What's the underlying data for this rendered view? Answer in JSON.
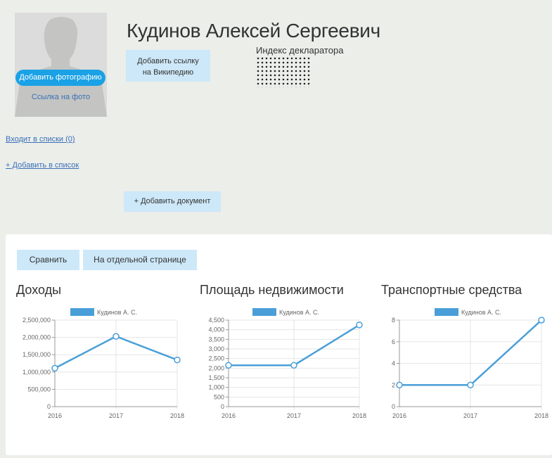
{
  "profile": {
    "name": "Кудинов Алексей Сергеевич",
    "add_photo": "Добавить фотографию",
    "photo_link": "Ссылка на фото",
    "wiki_line1": "Добавить ссылку",
    "wiki_line2": "на Википедию",
    "index_label": "Индекс декларатора",
    "lists_link": "Входит в списки (0)",
    "add_to_list": "+ Добавить в список",
    "add_document": "+ Добавить документ"
  },
  "panel": {
    "compare": "Сравнить",
    "separate_page": "На отдельной странице"
  },
  "colors": {
    "accent": "#1aa1e6",
    "button_bg": "#cde8f8",
    "series": "#4a9fd8",
    "link": "#3a70b8"
  },
  "chart_data": [
    {
      "type": "line",
      "title": "Доходы",
      "legend": "Кудинов А. С.",
      "x": [
        "2016",
        "2017",
        "2018"
      ],
      "values": [
        1110000,
        2030000,
        1350000
      ],
      "ylim": [
        0,
        2500000
      ],
      "yticks": [
        0,
        500000,
        1000000,
        1500000,
        2000000,
        2500000
      ],
      "ytick_labels": [
        "0",
        "500,000",
        "1,000,000",
        "1,500,000",
        "2,000,000",
        "2,500,000"
      ],
      "grid": true
    },
    {
      "type": "line",
      "title": "Площадь недвижимости",
      "legend": "Кудинов А. С.",
      "x": [
        "2016",
        "2017",
        "2018"
      ],
      "values": [
        2150,
        2150,
        4250
      ],
      "ylim": [
        0,
        4500
      ],
      "yticks": [
        0,
        500,
        1000,
        1500,
        2000,
        2500,
        3000,
        3500,
        4000,
        4500
      ],
      "ytick_labels": [
        "0",
        "500",
        "1,000",
        "1,500",
        "2,000",
        "2,500",
        "3,000",
        "3,500",
        "4,000",
        "4,500"
      ],
      "grid": true
    },
    {
      "type": "line",
      "title": "Транспортные средства",
      "legend": "Кудинов А. С.",
      "x": [
        "2016",
        "2017",
        "2018"
      ],
      "values": [
        2,
        2,
        8
      ],
      "ylim": [
        0,
        8
      ],
      "yticks": [
        0,
        2,
        4,
        6,
        8
      ],
      "ytick_labels": [
        "0",
        "2",
        "4",
        "6",
        "8"
      ],
      "grid": true
    }
  ]
}
